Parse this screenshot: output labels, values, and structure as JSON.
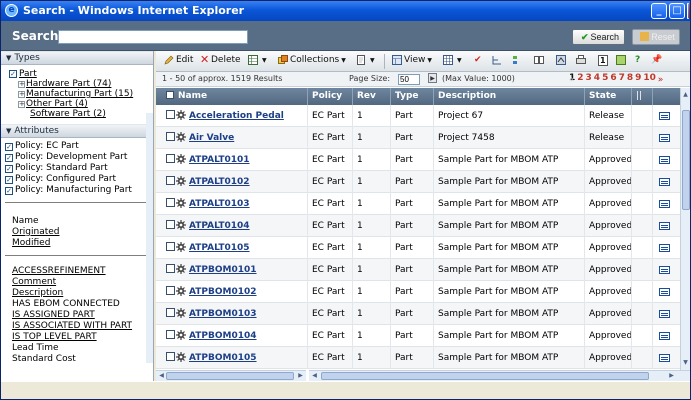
{
  "window": {
    "title": "Search - Windows Internet Explorer"
  },
  "search": {
    "label": "Search",
    "value": "",
    "search_button": "Search",
    "reset_button": "Reset"
  },
  "left": {
    "types_header": "Types",
    "tree": [
      {
        "label": "Part",
        "expander": "",
        "checked": true,
        "indent": 0
      },
      {
        "label": "Hardware Part (74)",
        "expander": "+",
        "indent": 1
      },
      {
        "label": "Manufacturing Part (15)",
        "expander": "+",
        "indent": 1
      },
      {
        "label": "Other Part (4)",
        "expander": "+",
        "indent": 1
      },
      {
        "label": "Software Part (2)",
        "expander": "",
        "indent": 2
      }
    ],
    "attributes_header": "Attributes",
    "policies": [
      "Policy: EC Part",
      "Policy: Development Part",
      "Policy: Standard Part",
      "Policy: Configured Part",
      "Policy: Manufacturing Part"
    ],
    "fields": [
      "Name",
      "Originated",
      "Modified"
    ],
    "more_fields": [
      "ACCESSREFINEMENT",
      "Comment",
      "Description",
      "HAS EBOM CONNECTED",
      "IS ASSIGNED PART",
      "IS ASSOCIATED WITH PART",
      "IS TOP LEVEL PART",
      "Lead Time",
      "Standard Cost"
    ]
  },
  "toolbar": {
    "edit": "Edit",
    "delete": "Delete",
    "collections": "Collections",
    "view": "View"
  },
  "info": {
    "results": "1 - 50 of approx. 1519 Results",
    "page_size_label": "Page Size:",
    "page_size_value": "50",
    "max_value": "(Max Value: 1000)",
    "pages": [
      "1",
      "2",
      "3",
      "4",
      "5",
      "6",
      "7",
      "8",
      "9",
      "10"
    ],
    "current_page": "1"
  },
  "grid": {
    "columns": [
      "Name",
      "Policy",
      "Rev",
      "Type",
      "Description",
      "State"
    ],
    "rows": [
      {
        "name": "Acceleration Pedal",
        "policy": "EC Part",
        "rev": "1",
        "type": "Part",
        "description": "Project 67",
        "state": "Release"
      },
      {
        "name": "Air Valve",
        "policy": "EC Part",
        "rev": "1",
        "type": "Part",
        "description": "Project 7458",
        "state": "Release"
      },
      {
        "name": "ATPALT0101",
        "policy": "EC Part",
        "rev": "1",
        "type": "Part",
        "description": "Sample Part for MBOM ATP",
        "state": "Approved"
      },
      {
        "name": "ATPALT0102",
        "policy": "EC Part",
        "rev": "1",
        "type": "Part",
        "description": "Sample Part for MBOM ATP",
        "state": "Approved"
      },
      {
        "name": "ATPALT0103",
        "policy": "EC Part",
        "rev": "1",
        "type": "Part",
        "description": "Sample Part for MBOM ATP",
        "state": "Approved"
      },
      {
        "name": "ATPALT0104",
        "policy": "EC Part",
        "rev": "1",
        "type": "Part",
        "description": "Sample Part for MBOM ATP",
        "state": "Approved"
      },
      {
        "name": "ATPALT0105",
        "policy": "EC Part",
        "rev": "1",
        "type": "Part",
        "description": "Sample Part for MBOM ATP",
        "state": "Approved"
      },
      {
        "name": "ATPBOM0101",
        "policy": "EC Part",
        "rev": "1",
        "type": "Part",
        "description": "Sample Part for MBOM ATP",
        "state": "Approved"
      },
      {
        "name": "ATPBOM0102",
        "policy": "EC Part",
        "rev": "1",
        "type": "Part",
        "description": "Sample Part for MBOM ATP",
        "state": "Approved"
      },
      {
        "name": "ATPBOM0103",
        "policy": "EC Part",
        "rev": "1",
        "type": "Part",
        "description": "Sample Part for MBOM ATP",
        "state": "Approved"
      },
      {
        "name": "ATPBOM0104",
        "policy": "EC Part",
        "rev": "1",
        "type": "Part",
        "description": "Sample Part for MBOM ATP",
        "state": "Approved"
      },
      {
        "name": "ATPBOM0105",
        "policy": "EC Part",
        "rev": "1",
        "type": "Part",
        "description": "Sample Part for MBOM ATP",
        "state": "Approved"
      }
    ]
  },
  "colors": {
    "title_bar": "#0a57d8",
    "search_bar": "#586e86",
    "grid_header": "#5f7690",
    "link": "#1d3f87",
    "page_link": "#c0392b"
  }
}
